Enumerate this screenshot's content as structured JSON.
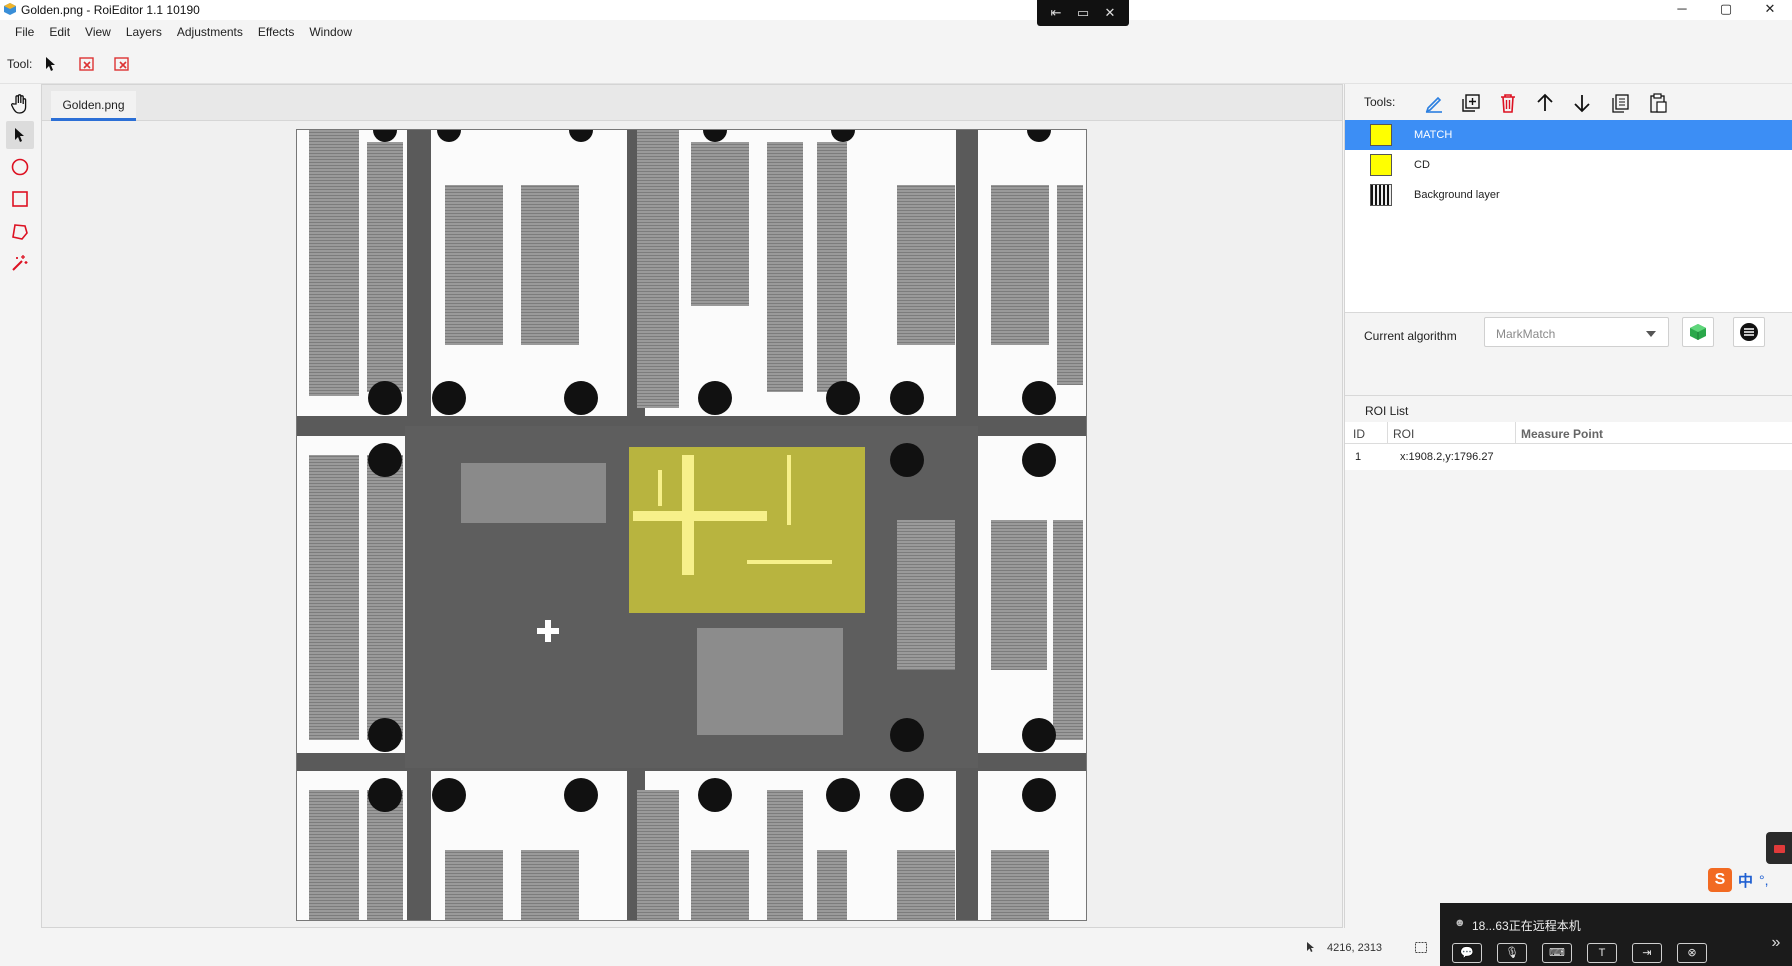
{
  "window": {
    "title": "Golden.png - RoiEditor 1.1 10190",
    "controls": [
      "─",
      "▢",
      "✕"
    ],
    "remote_pill_icons": [
      "⇤",
      "▭",
      "✕"
    ]
  },
  "menu": [
    "File",
    "Edit",
    "View",
    "Layers",
    "Adjustments",
    "Effects",
    "Window"
  ],
  "toolbar": {
    "label": "Tool:",
    "buttons": [
      "pointer-icon",
      "delete-roi-icon",
      "delete-all-roi-icon"
    ]
  },
  "left_tools": [
    "hand-icon",
    "select-arrow-icon",
    "circle-icon",
    "rectangle-icon",
    "polygon-icon",
    "magic-wand-icon"
  ],
  "document": {
    "tab_label": "Golden.png"
  },
  "right_panel": {
    "tools_label": "Tools:",
    "tool_icons": [
      "edit-pen-icon",
      "add-layer-icon",
      "delete-layer-icon",
      "move-up-icon",
      "move-down-icon",
      "copy-icon",
      "paste-icon"
    ],
    "layers": [
      {
        "name": "MATCH",
        "selected": true,
        "color": "#ffff00"
      },
      {
        "name": "CD",
        "selected": false,
        "color": "#ffff00"
      },
      {
        "name": "Background layer",
        "selected": false,
        "color": "#777777"
      }
    ],
    "algorithm": {
      "label": "Current algorithm",
      "selected": "MarkMatch"
    },
    "roi_list": {
      "title": "ROI List",
      "columns": [
        "ID",
        "ROI",
        "Measure Point"
      ],
      "rows": [
        {
          "id": "1",
          "roi": "x:1908.2,y:1796.27",
          "measure_point": ""
        }
      ]
    }
  },
  "status": {
    "coords": "4216, 2313"
  },
  "ime": {
    "logo": "S",
    "mode": "中",
    "punct": "°,"
  },
  "remote_bar": {
    "text": "18...63正在远程本机",
    "icons": [
      "💬",
      "🎙",
      "⌨",
      "T",
      "⇥",
      "⊗"
    ],
    "expand": "»"
  },
  "colors": {
    "accent": "#2b6fd6",
    "selected_layer": "#3c8ef5",
    "roi_highlight": "#ffff00"
  }
}
